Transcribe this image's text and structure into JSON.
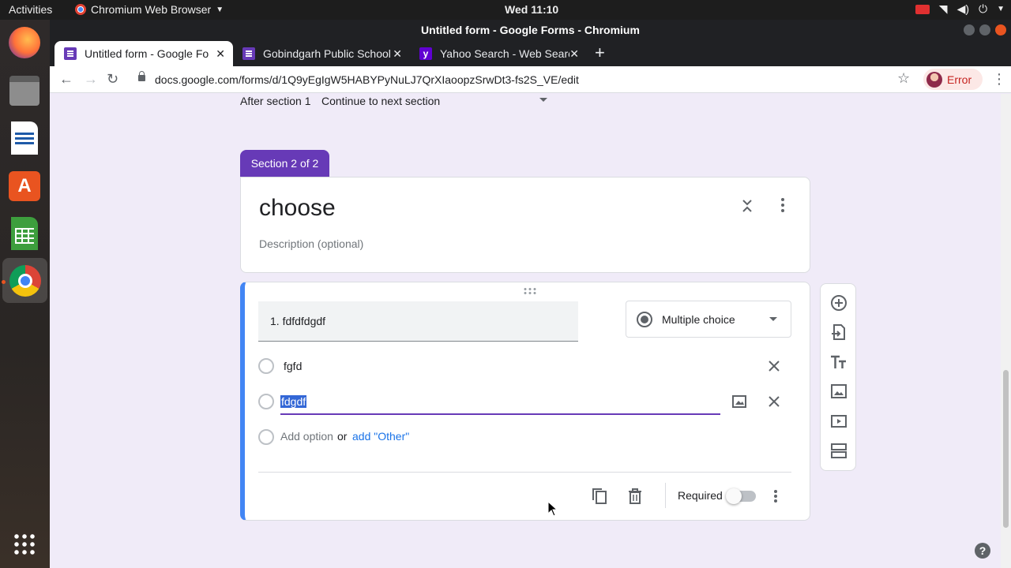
{
  "system": {
    "activities": "Activities",
    "app_menu": "Chromium Web Browser",
    "clock": "Wed 11:10"
  },
  "window": {
    "title": "Untitled form - Google Forms - Chromium"
  },
  "tabs": [
    {
      "title": "Untitled form - Google Fo",
      "icon": "google-forms-icon"
    },
    {
      "title": "Gobindgarh Public School",
      "icon": "google-forms-icon"
    },
    {
      "title": "Yahoo Search - Web Searc",
      "icon": "yahoo-icon"
    }
  ],
  "tab_close_glyph": "✕",
  "new_tab_glyph": "+",
  "toolbar": {
    "url": "docs.google.com/forms/d/1Q9yEgIgW5HABYPyNuLJ7QrXIaoopzSrwDt3-fs2S_VE/edit",
    "profile_label": "Error"
  },
  "form": {
    "after_section_label": "After section 1",
    "after_section_value": "Continue to next section",
    "section_badge": "Section 2 of 2",
    "section_title": "choose",
    "section_description_placeholder": "Description (optional)",
    "question": {
      "title": "1. fdfdfdgdf",
      "type": "Multiple choice",
      "options": [
        "fgfd",
        "fdgdf"
      ],
      "add_option": "Add option",
      "or": "or",
      "add_other": "add \"Other\"",
      "required_label": "Required",
      "required_on": false
    }
  },
  "colors": {
    "accent": "#673ab7",
    "active_question_border": "#4285f4",
    "page_background": "#f0ebf8",
    "link": "#1a73e8"
  }
}
